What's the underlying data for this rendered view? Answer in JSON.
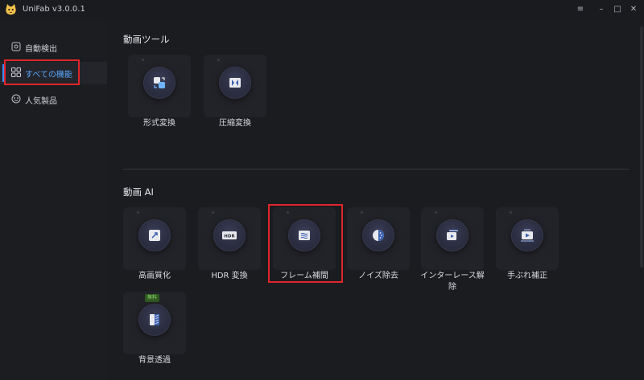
{
  "app": {
    "title": "UniFab v3.0.0.1"
  },
  "window_controls": {
    "menu": "≡",
    "minimize": "–",
    "maximize": "□",
    "close": "✕"
  },
  "sidebar": {
    "items": [
      {
        "label": "自動検出",
        "icon": "auto-detect-icon"
      },
      {
        "label": "すべての機能",
        "icon": "grid-icon",
        "active": true
      },
      {
        "label": "人気製品",
        "icon": "popular-icon"
      }
    ]
  },
  "sections": {
    "video_tools": {
      "title": "動画ツール",
      "cards": [
        {
          "label": "形式変換",
          "icon": "convert-icon"
        },
        {
          "label": "圧縮変換",
          "icon": "compress-icon"
        }
      ]
    },
    "video_ai": {
      "title": "動画 AI",
      "cards": [
        {
          "label": "高画質化",
          "icon": "upscale-icon"
        },
        {
          "label": "HDR 変換",
          "icon": "hdr-icon",
          "icon_text": "HDR"
        },
        {
          "label": "フレーム補間",
          "icon": "frame-interpolation-icon"
        },
        {
          "label": "ノイズ除去",
          "icon": "denoise-icon"
        },
        {
          "label": "インターレース解除",
          "label_line1": "インターレース解",
          "label_line2": "除",
          "icon": "deinterlace-icon"
        },
        {
          "label": "手ぶれ補正",
          "icon": "stabilize-icon"
        },
        {
          "label": "背景透過",
          "icon": "background-remove-icon",
          "badge": "無料"
        }
      ]
    }
  },
  "colors": {
    "accent": "#3b8cff",
    "highlight_box": "#e0262b",
    "background": "#1b1c20",
    "card": "#222328"
  }
}
